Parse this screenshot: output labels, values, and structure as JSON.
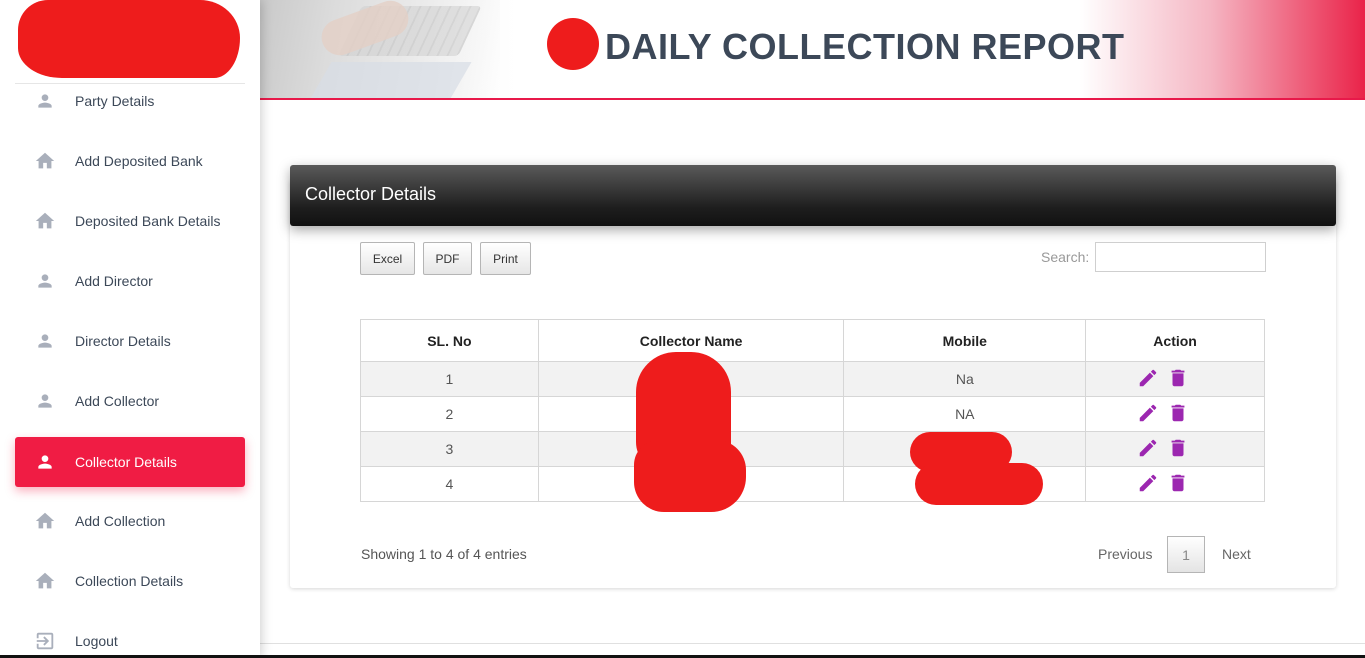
{
  "header": {
    "title": "DAILY COLLECTION REPORT"
  },
  "sidebar": {
    "items": [
      {
        "label": "Party Details",
        "icon": "person-icon"
      },
      {
        "label": "Add Deposited Bank",
        "icon": "home-icon"
      },
      {
        "label": "Deposited Bank Details",
        "icon": "home-icon"
      },
      {
        "label": "Add Director",
        "icon": "person-icon"
      },
      {
        "label": "Director Details",
        "icon": "person-icon"
      },
      {
        "label": "Add Collector",
        "icon": "person-icon"
      },
      {
        "label": "Collector Details",
        "icon": "person-icon",
        "active": true
      },
      {
        "label": "Add Collection",
        "icon": "home-icon"
      },
      {
        "label": "Collection Details",
        "icon": "home-icon"
      },
      {
        "label": "Logout",
        "icon": "logout-icon"
      }
    ]
  },
  "card": {
    "title": "Collector Details",
    "buttons": {
      "excel": "Excel",
      "pdf": "PDF",
      "print": "Print"
    },
    "search_label": "Search:"
  },
  "table": {
    "headers": [
      "SL. No",
      "Collector Name",
      "Mobile",
      "Action"
    ],
    "rows": [
      {
        "sl": "1",
        "name": "",
        "mobile": "Na"
      },
      {
        "sl": "2",
        "name": "",
        "mobile": "NA"
      },
      {
        "sl": "3",
        "name": "",
        "mobile": ""
      },
      {
        "sl": "4",
        "name": "",
        "mobile": ""
      }
    ]
  },
  "footer": {
    "info": "Showing 1 to 4 of 4 entries",
    "pagination": {
      "previous": "Previous",
      "current": "1",
      "next": "Next"
    }
  },
  "colors": {
    "accent": "#f01c44",
    "action_icon": "#9c27b0",
    "sidebar_icon": "#a9afbb"
  }
}
